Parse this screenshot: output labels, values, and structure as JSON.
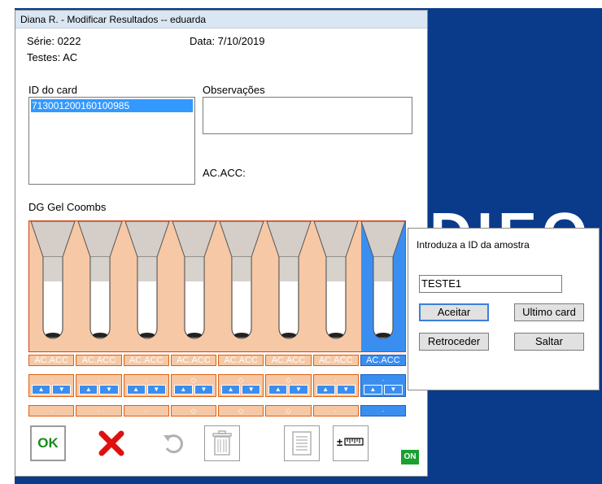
{
  "desktop": {
    "brand_text": "DIEO"
  },
  "window": {
    "title": "Diana R. - Modificar Resultados -- eduarda",
    "serie": "Série: 0222",
    "data": "Data: 7/10/2019",
    "testes": "Testes: AC",
    "id_card_label": "ID do card",
    "id_card_items": [
      "713001200160100985"
    ],
    "observacoes_label": "Observações",
    "observacoes_value": "",
    "acacc_label": "AC.ACC:",
    "gel_label": "DG Gel Coombs",
    "results": [
      "AC.ACC",
      "AC.ACC",
      "AC.ACC",
      "AC.ACC",
      "AC.ACC",
      "AC.ACC",
      "AC.ACC",
      "AC.ACC"
    ],
    "step_tags": [
      "·",
      "·",
      "·",
      "◇",
      "◇",
      "◇",
      "·",
      "·"
    ],
    "bar_tags": [
      "·",
      "·",
      "·",
      "◇",
      "◇",
      "◇",
      "·",
      "·"
    ],
    "selected_column": 8,
    "toolbar": {
      "ok_label": "OK",
      "on_badge": "ON"
    }
  },
  "dialog": {
    "prompt": "Introduza a ID da amostra",
    "input_value": "TESTE1",
    "aceitar_label": "Aceitar",
    "ultimo_label": "Ultimo card",
    "retroceder_label": "Retroceder",
    "saltar_label": "Saltar"
  },
  "colors": {
    "accent": "#3a8ef0",
    "gel": "#f6c8a5",
    "ok_green": "#1a8a1a",
    "desktop_blue": "#0a3a8a"
  }
}
